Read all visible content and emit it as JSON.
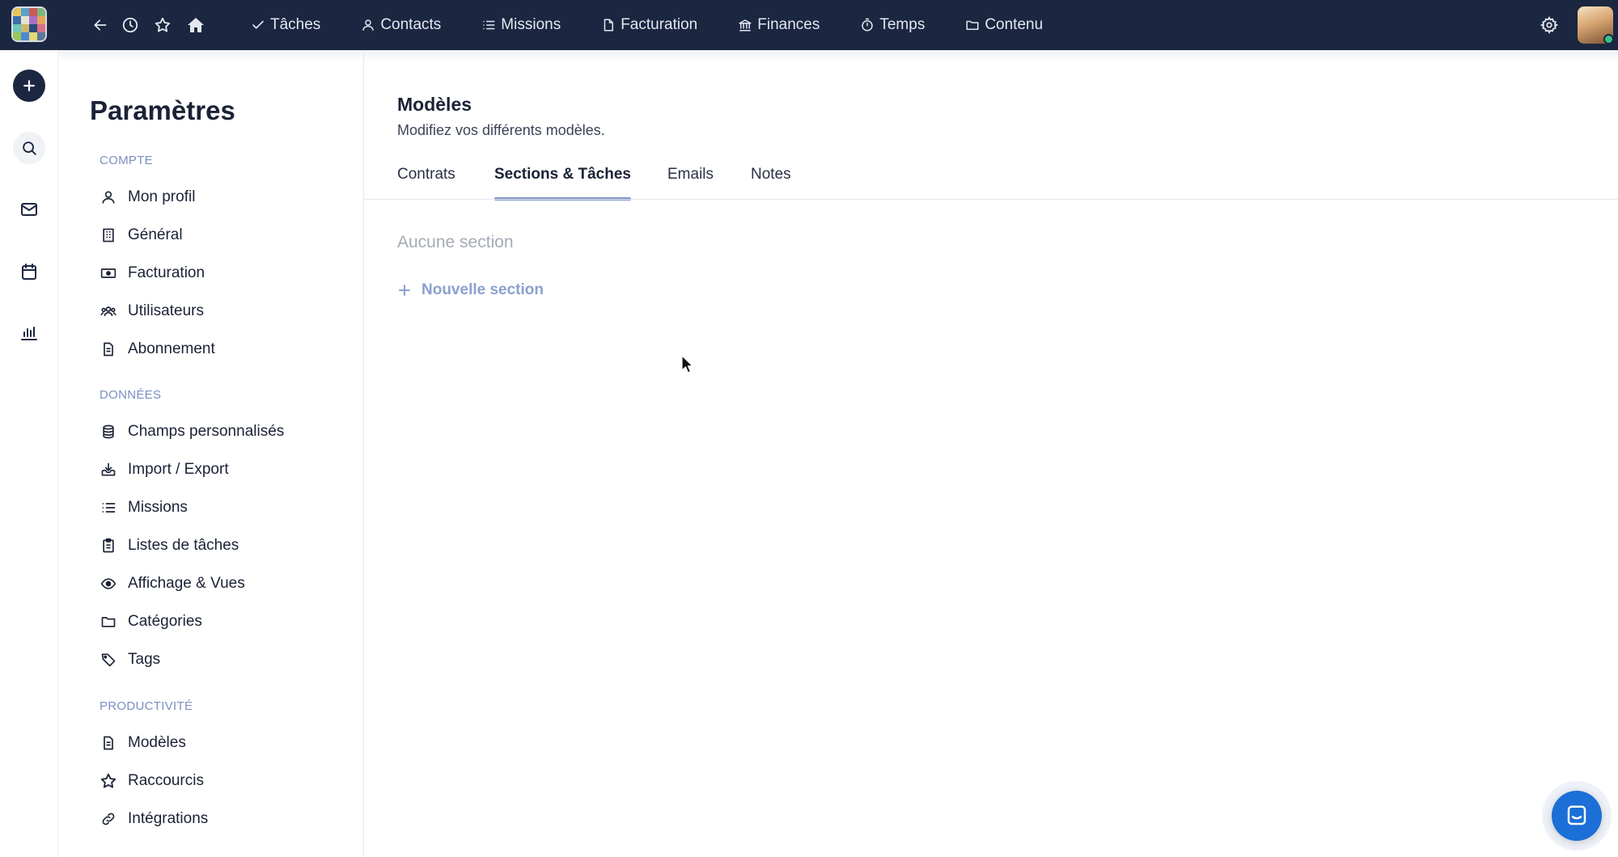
{
  "topbar": {
    "nav": [
      {
        "label": "Tâches",
        "icon": "check-icon"
      },
      {
        "label": "Contacts",
        "icon": "user-icon"
      },
      {
        "label": "Missions",
        "icon": "list-icon"
      },
      {
        "label": "Facturation",
        "icon": "document-icon"
      },
      {
        "label": "Finances",
        "icon": "bank-icon"
      },
      {
        "label": "Temps",
        "icon": "stopwatch-icon"
      },
      {
        "label": "Contenu",
        "icon": "folder-icon"
      }
    ]
  },
  "settings": {
    "title": "Paramètres",
    "groups": [
      {
        "label": "COMPTE",
        "items": [
          "Mon profil",
          "Général",
          "Facturation",
          "Utilisateurs",
          "Abonnement"
        ]
      },
      {
        "label": "DONNÉES",
        "items": [
          "Champs personnalisés",
          "Import / Export",
          "Missions",
          "Listes de tâches",
          "Affichage & Vues",
          "Catégories",
          "Tags"
        ]
      },
      {
        "label": "PRODUCTIVITÉ",
        "items": [
          "Modèles",
          "Raccourcis",
          "Intégrations"
        ]
      }
    ]
  },
  "main": {
    "title": "Modèles",
    "subtitle": "Modifiez vos différents modèles.",
    "tabs": [
      {
        "label": "Contrats",
        "active": false
      },
      {
        "label": "Sections & Tâches",
        "active": true
      },
      {
        "label": "Emails",
        "active": false
      },
      {
        "label": "Notes",
        "active": false
      }
    ],
    "empty_text": "Aucune section",
    "new_section_label": "Nouvelle section"
  },
  "colors": {
    "topbar": "#1b2640",
    "accent": "#7c93c8",
    "group_label": "#7b8fc0",
    "chat": "#1b6fd6"
  }
}
